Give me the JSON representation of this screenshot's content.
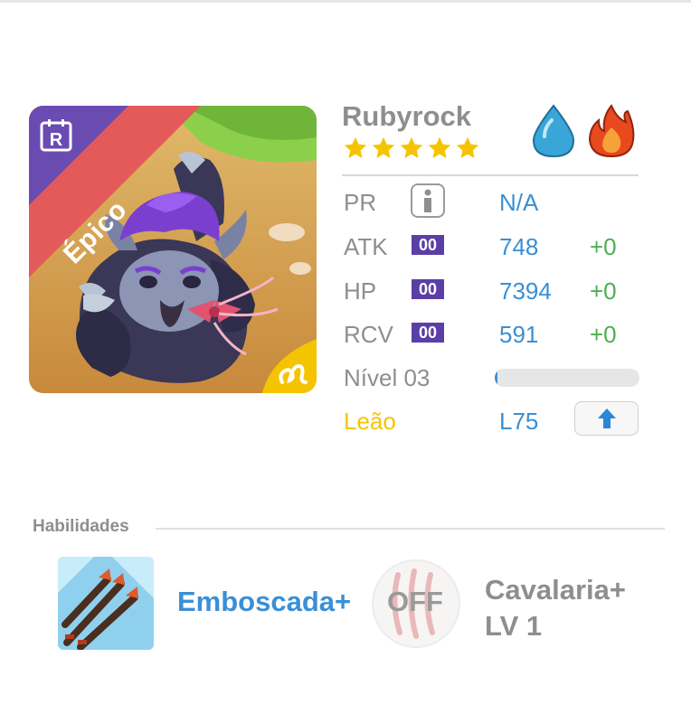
{
  "monster": {
    "name": "Rubyrock",
    "rarity_label": "Épico",
    "rarity_badge": "R",
    "stars": 5,
    "elements": [
      "water-drop-icon",
      "fire-icon"
    ],
    "colors": {
      "water": "#3aa6d8",
      "fire": "#e8491d",
      "ribbon": "#e45a5a",
      "purple": "#6a4bb2"
    }
  },
  "stats": {
    "pr": {
      "label": "PR",
      "value": "N/A"
    },
    "atk": {
      "label": "ATK",
      "badge": "00",
      "value": "748",
      "bonus": "+0"
    },
    "hp": {
      "label": "HP",
      "badge": "00",
      "value": "7394",
      "bonus": "+0"
    },
    "rcv": {
      "label": "RCV",
      "badge": "00",
      "value": "591",
      "bonus": "+0"
    },
    "level": {
      "label": "Nível 03",
      "progress": 0.01
    },
    "zodiac": {
      "label": "Leão",
      "value": "L75"
    }
  },
  "skills": {
    "title": "Habilidades",
    "active": {
      "name": "Emboscada+"
    },
    "leader": {
      "status": "OFF",
      "name_line1": "Cavalaria+",
      "name_line2": "LV 1"
    }
  }
}
